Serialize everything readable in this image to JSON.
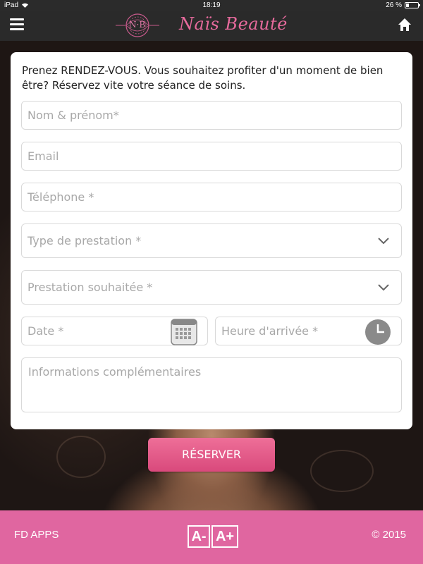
{
  "status_bar": {
    "device": "iPad",
    "time": "18:19",
    "battery": "26 %"
  },
  "header": {
    "logo_monogram": "N·B",
    "logo_text": "Naïs Beauté",
    "menu_icon": "hamburger-menu-icon",
    "home_icon": "home-icon"
  },
  "form": {
    "intro": "Prenez RENDEZ-VOUS. Vous souhaitez profiter d'un moment de bien être? Réservez vite votre séance de soins.",
    "name_placeholder": "Nom & prénom*",
    "email_placeholder": "Email",
    "phone_placeholder": "Téléphone *",
    "service_type_placeholder": "Type de prestation *",
    "service_wanted_placeholder": "Prestation souhaitée *",
    "date_placeholder": "Date *",
    "arrival_time_placeholder": "Heure d'arrivée *",
    "info_placeholder": "Informations complémentaires",
    "submit_label": "RÉSERVER"
  },
  "footer": {
    "brand": "FD APPS",
    "font_decrease": "A-",
    "font_increase": "A+",
    "copyright": "© 2015"
  },
  "colors": {
    "accent_pink": "#e066a0",
    "button_pink": "#e65a8a",
    "header_dark": "#2a2a2a"
  }
}
